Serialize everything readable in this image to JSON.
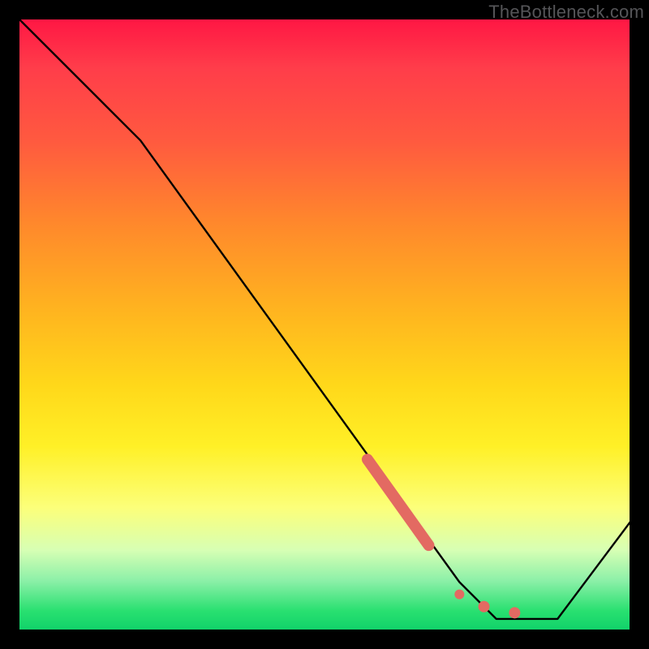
{
  "watermark": "TheBottleneck.com",
  "chart_data": {
    "type": "line",
    "title": "",
    "xlabel": "",
    "ylabel": "",
    "xlim": [
      0,
      100
    ],
    "ylim": [
      0,
      100
    ],
    "grid": false,
    "legend": false,
    "series": [
      {
        "name": "bottleneck-curve",
        "color": "#000000",
        "points": [
          {
            "x": 0,
            "y": 100
          },
          {
            "x": 20,
            "y": 80
          },
          {
            "x": 72,
            "y": 8
          },
          {
            "x": 78,
            "y": 2
          },
          {
            "x": 88,
            "y": 2
          },
          {
            "x": 100,
            "y": 18
          }
        ]
      }
    ],
    "highlights": [
      {
        "name": "red-band",
        "color": "#e36a62",
        "segment_start": {
          "x": 57,
          "y": 28
        },
        "segment_end": {
          "x": 67,
          "y": 14
        },
        "thickness_px": 14
      },
      {
        "name": "red-dot-1",
        "color": "#e36a62",
        "point": {
          "x": 72,
          "y": 6
        },
        "radius_px": 6
      },
      {
        "name": "red-dot-2",
        "color": "#e36a62",
        "point": {
          "x": 76,
          "y": 4
        },
        "radius_px": 7
      },
      {
        "name": "red-dot-3",
        "color": "#e36a62",
        "point": {
          "x": 81,
          "y": 3
        },
        "radius_px": 7
      }
    ],
    "background_gradient_meaning": "red = high bottleneck, green = low bottleneck"
  }
}
